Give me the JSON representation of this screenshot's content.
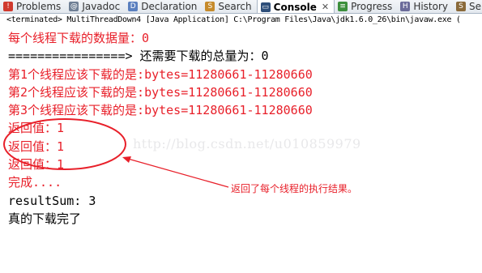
{
  "tabs": [
    {
      "label": "Problems",
      "icon": "problems-icon",
      "color": "#d03a2e",
      "glyph": "!"
    },
    {
      "label": "Javadoc",
      "icon": "javadoc-icon",
      "color": "#6f7f95",
      "glyph": "@"
    },
    {
      "label": "Declaration",
      "icon": "declaration-icon",
      "color": "#5a7fbf",
      "glyph": "D"
    },
    {
      "label": "Search",
      "icon": "search-icon",
      "color": "#c68b2c",
      "glyph": "S"
    },
    {
      "label": "Console",
      "icon": "console-icon",
      "color": "#2f4f7a",
      "glyph": "▭",
      "active": true,
      "close": "✕"
    },
    {
      "label": "Progress",
      "icon": "progress-icon",
      "color": "#3c8f3c",
      "glyph": "≡"
    },
    {
      "label": "History",
      "icon": "history-icon",
      "color": "#6b6b9a",
      "glyph": "H"
    },
    {
      "label": "Serve",
      "icon": "servers-icon",
      "color": "#8a6a3a",
      "glyph": "S"
    }
  ],
  "console_header": "<terminated> MultiThreadDown4 [Java Application] C:\\Program Files\\Java\\jdk1.6.0_26\\bin\\javaw.exe (",
  "output_lines": [
    {
      "text": "每个线程下载的数据量：0",
      "color": "red"
    },
    {
      "text": "================> 还需要下载的总量为：0",
      "color": "black"
    },
    {
      "text": "第1个线程应该下载的是:bytes=11280661-11280660",
      "color": "red"
    },
    {
      "text": "第2个线程应该下载的是:bytes=11280661-11280660",
      "color": "red"
    },
    {
      "text": "第3个线程应该下载的是:bytes=11280661-11280660",
      "color": "red"
    },
    {
      "text": "返回值：1",
      "color": "red"
    },
    {
      "text": "返回值：1",
      "color": "red"
    },
    {
      "text": "返回值：1",
      "color": "red"
    },
    {
      "text": "完成....",
      "color": "red"
    },
    {
      "text": "resultSum: 3",
      "color": "black"
    },
    {
      "text": "真的下载完了",
      "color": "black"
    }
  ],
  "watermark": "http://blog.csdn.net/u010859979",
  "annotation": {
    "text": "返回了每个线程的执行结果。",
    "color": "#e8202a"
  }
}
